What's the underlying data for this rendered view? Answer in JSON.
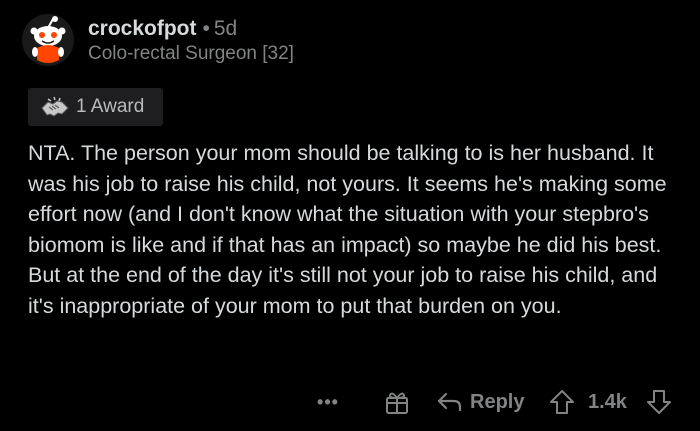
{
  "comment": {
    "username": "crockofpot",
    "separator": "•",
    "age": "5d",
    "flair": "Colo-rectal Surgeon [32]",
    "award_label": "1 Award",
    "body": "NTA. The person your mom should be talking to is her husband. It was his job to raise his child, not yours. It seems he's making some effort now (and I don't know what the situation with your stepbro's biomom is like and if that has an impact) so maybe he did his best. But at the end of the day it's still not your job to raise his child, and it's inappropriate of your mom to put that burden on you."
  },
  "actions": {
    "more_label": "•••",
    "reply_label": "Reply",
    "score": "1.4k"
  },
  "icons": {
    "avatar": "snoo-avatar-icon",
    "award": "handshake-award-icon",
    "gift": "gift-award-icon",
    "reply": "reply-arrow-icon",
    "upvote": "upvote-arrow-icon",
    "downvote": "downvote-arrow-icon"
  },
  "colors": {
    "background": "#000000",
    "text_primary": "#d7dadc",
    "text_secondary": "#818384",
    "award_chip_bg": "#1e1e20",
    "avatar_accent": "#ff4500"
  }
}
